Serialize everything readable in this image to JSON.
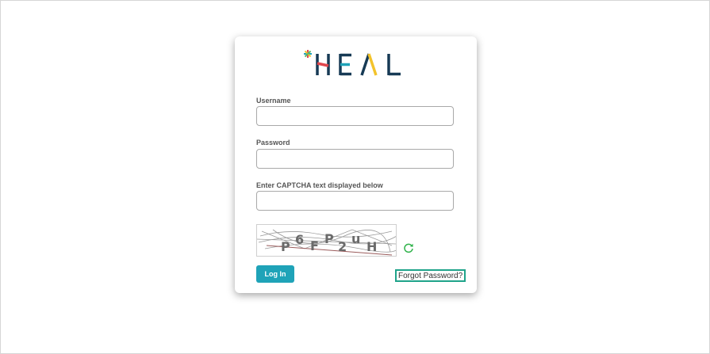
{
  "brand": {
    "name": "HEAL",
    "colors": {
      "dark": "#173a55",
      "red": "#e0464c",
      "yellow": "#f3c32b",
      "teal": "#1fa3b8",
      "green": "#5bb36a"
    }
  },
  "form": {
    "username_label": "Username",
    "username_value": "",
    "password_label": "Password",
    "password_value": "",
    "captcha_label": "Enter CAPTCHA text displayed below",
    "captcha_value": "",
    "captcha_text": "P6FP2uH",
    "refresh_icon": "refresh-icon",
    "login_label": "Log In",
    "forgot_label": "Forgot Password?"
  },
  "colors": {
    "button": "#1fa3b8",
    "forgot_border": "#1fa38a",
    "refresh": "#2fb24a"
  }
}
